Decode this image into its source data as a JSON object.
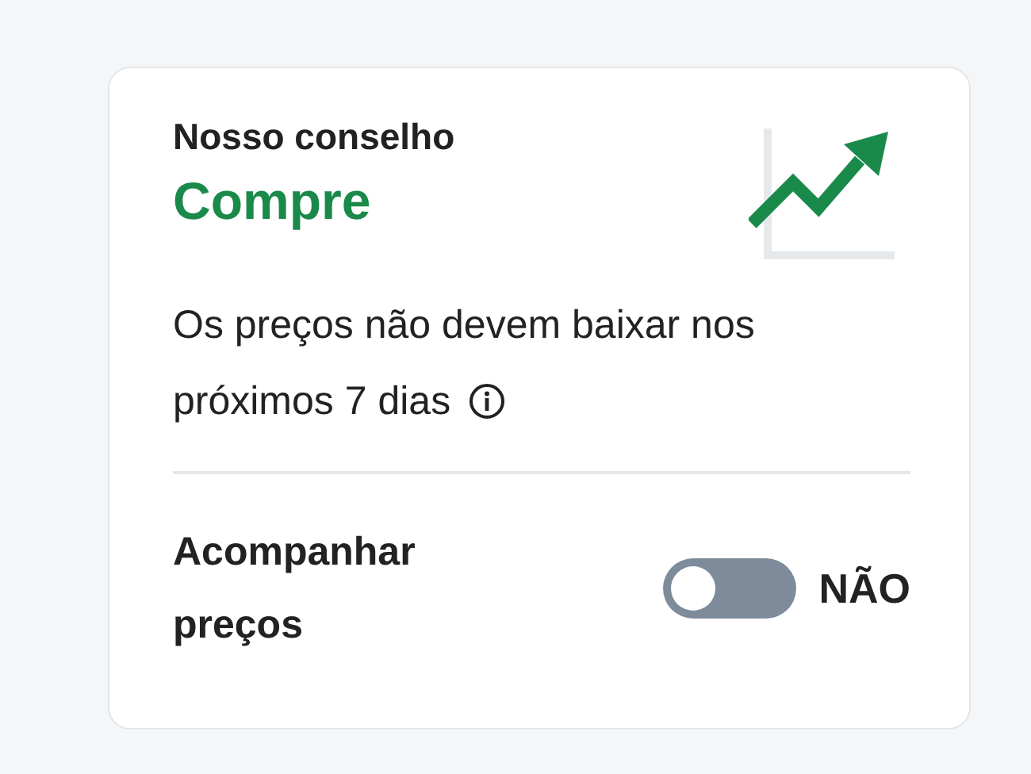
{
  "advice": {
    "label": "Nosso conselho",
    "verdict": "Compre",
    "description": "Os preços não devem baixar nos próximos 7 dias"
  },
  "tracking": {
    "label": "Acompanhar preços",
    "on": false,
    "state_text": "NÃO"
  }
}
